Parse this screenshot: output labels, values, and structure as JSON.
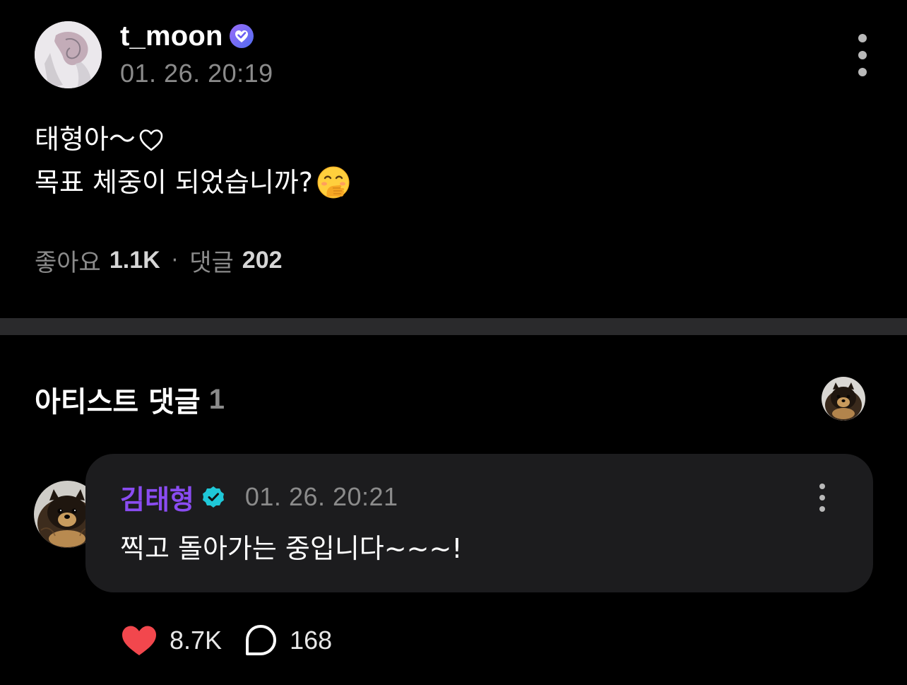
{
  "post": {
    "author": "t_moon",
    "verified": true,
    "timestamp": "01. 26. 20:19",
    "lines": [
      {
        "text": "태형아～",
        "trailing_icon": "heart-outline-icon"
      },
      {
        "text": "목표 체중이 되었습니까?",
        "trailing_icon": "hand-over-mouth-emoji"
      }
    ],
    "likes_label": "좋아요",
    "likes_count": "1.1K",
    "separator": "·",
    "comments_label": "댓글",
    "comments_count": "202"
  },
  "artist_comments": {
    "title": "아티스트 댓글",
    "count": "1",
    "comments": [
      {
        "author": "김태형",
        "verified": true,
        "timestamp": "01. 26. 20:21",
        "text": "찍고 돌아가는 중입니다~~~!",
        "likes": "8.7K",
        "replies": "168"
      }
    ]
  },
  "colors": {
    "background": "#000000",
    "secondary_text": "#8b8b8b",
    "artist_name": "#8a4cf1",
    "comment_bubble": "#1c1c1e",
    "like_heart": "#f2474d",
    "verified_badge_purple": "#7d5cf6",
    "verified_badge_teal": "#1fc8d8"
  }
}
